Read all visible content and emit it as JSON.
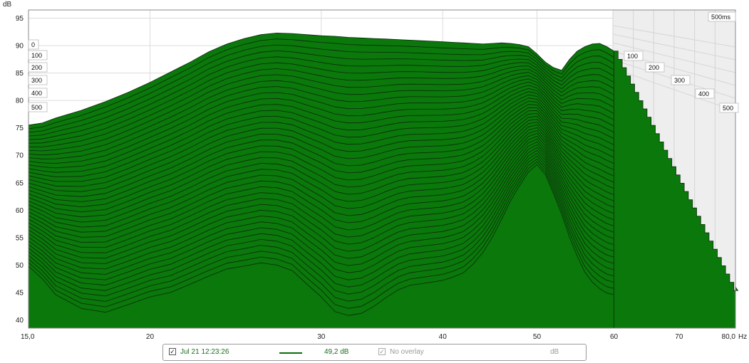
{
  "chart_data": {
    "type": "area",
    "title": "",
    "ylabel": "dB",
    "xlabel": "Hz",
    "x_ticks": [
      "15,0",
      "20",
      "30",
      "40",
      "50",
      "60",
      "70",
      "80,0"
    ],
    "x_tick_values": [
      15,
      20,
      30,
      40,
      50,
      60,
      70,
      80
    ],
    "y_ticks": [
      "95",
      "90",
      "85",
      "80",
      "75",
      "70",
      "65",
      "60",
      "55",
      "50",
      "45",
      "40"
    ],
    "y_tick_values": [
      95,
      90,
      85,
      80,
      75,
      70,
      65,
      60,
      55,
      50,
      45,
      40
    ],
    "xlim": [
      15,
      80
    ],
    "ylim": [
      38.5,
      96.5
    ],
    "x_scale": "log",
    "grid": true,
    "time_labels_left": [
      "0",
      "100",
      "200",
      "300",
      "400",
      "500"
    ],
    "time_labels_right": [
      "100",
      "200",
      "300",
      "400",
      "500"
    ],
    "time_corner_label": "500ms",
    "time_slices_ms": [
      0,
      500
    ],
    "fill_color": "#0a780a",
    "line_color": "#0c2a0c",
    "series": [
      {
        "name": "0 ms",
        "x": [
          15,
          15.5,
          16,
          17,
          18,
          19,
          20,
          21,
          22,
          23,
          24,
          25,
          26,
          27,
          28,
          29,
          30,
          31,
          32,
          33,
          34,
          35,
          36,
          37,
          38,
          39,
          40,
          41,
          42,
          43,
          44,
          45,
          46,
          47,
          48,
          49,
          50,
          51,
          52,
          53,
          54,
          55,
          56,
          57,
          58,
          59,
          60
        ],
        "values": [
          75.5,
          75.9,
          76.8,
          78.2,
          79.8,
          81.5,
          83.3,
          85.2,
          87.0,
          88.9,
          90.3,
          91.3,
          92.0,
          92.3,
          92.2,
          92.0,
          91.8,
          91.7,
          91.5,
          91.4,
          91.3,
          91.2,
          91.1,
          91.0,
          90.9,
          90.8,
          90.7,
          90.6,
          90.5,
          90.4,
          90.3,
          90.4,
          90.5,
          90.4,
          90.2,
          89.8,
          88.5,
          87.0,
          86.0,
          85.5,
          87.5,
          89.0,
          89.8,
          90.3,
          90.4,
          89.8,
          89.0
        ]
      },
      {
        "name": "500 ms",
        "x": [
          15,
          15.5,
          16,
          17,
          18,
          19,
          20,
          21,
          22,
          23,
          24,
          25,
          26,
          27,
          28,
          29,
          30,
          31,
          32,
          33,
          34,
          35,
          36,
          37,
          38,
          39,
          40,
          41,
          42,
          43,
          44,
          45,
          46,
          47,
          48,
          49,
          50,
          51,
          52,
          53,
          54,
          55,
          56,
          57,
          58,
          59,
          60
        ],
        "values": [
          49.8,
          47.5,
          44.6,
          42.1,
          41.4,
          42.8,
          44.2,
          45.0,
          46.5,
          48.0,
          49.3,
          49.8,
          50.4,
          50.0,
          49.0,
          46.5,
          44.2,
          41.5,
          40.8,
          41.2,
          42.5,
          44.1,
          45.5,
          46.3,
          46.6,
          46.9,
          47.2,
          47.8,
          48.6,
          50.2,
          52.3,
          55.1,
          58.4,
          61.8,
          64.5,
          67.0,
          68.3,
          66.5,
          63.0,
          59.3,
          55.1,
          51.6,
          48.7,
          46.9,
          45.7,
          44.9,
          44.6
        ]
      }
    ]
  },
  "legend": {
    "date_label": "Jul 21 12:23:26",
    "value_label": "49,2 dB",
    "overlay_label": "No overlay",
    "unit_label": "dB",
    "check_mark": "✓"
  }
}
